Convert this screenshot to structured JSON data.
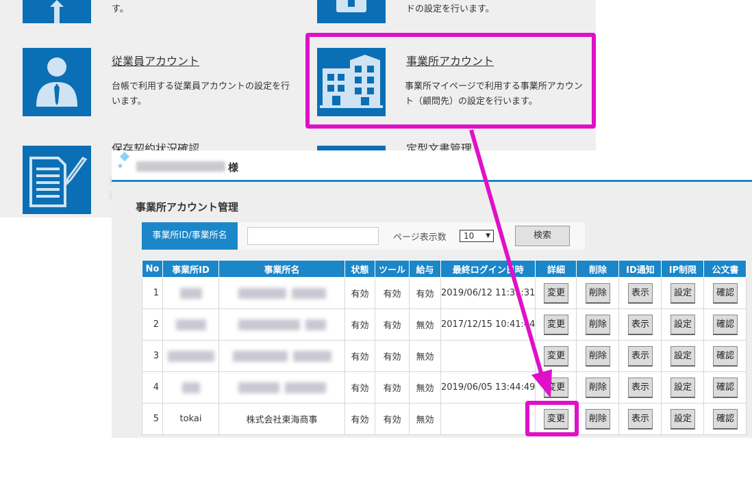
{
  "menu": {
    "top_left_desc": "す。",
    "top_right_desc": "ドの設定を行います。",
    "employee": {
      "title": "従業員アカウント",
      "desc_line1": "台帳で利用する従業員アカウントの設定を行",
      "desc_line2": "います。"
    },
    "office": {
      "title": "事業所アカウント",
      "desc_line1": "事業所マイページで利用する事業所アカウン",
      "desc_line2": "ト（顧問先）の設定を行います。"
    },
    "bottom_left_title_partial": "保存契約状況確認",
    "bottom_right_title_partial": "定型文書管理"
  },
  "header": {
    "user_suffix": "様"
  },
  "page": {
    "title": "事業所アカウント管理"
  },
  "search": {
    "label": "事業所ID/事業所名",
    "input_value": "",
    "page_size_label": "ページ表示数",
    "page_size_value": "10",
    "button_label": "検索"
  },
  "table": {
    "columns": [
      "No",
      "事業所ID",
      "事業所名",
      "状態",
      "ツール",
      "給与",
      "最終ログイン日時",
      "詳細",
      "削除",
      "ID通知",
      "IP制限",
      "公文書"
    ],
    "rows": [
      {
        "no": "1",
        "office_id": "",
        "office_name": "",
        "status": "有効",
        "tool": "有効",
        "salary": "有効",
        "last_login": "2019/06/12 11:31:31",
        "detail": "変更",
        "delete": "削除",
        "id_notice": "表示",
        "ip_limit": "設定",
        "document": "確認"
      },
      {
        "no": "2",
        "office_id": "",
        "office_name": "",
        "status": "有効",
        "tool": "有効",
        "salary": "無効",
        "last_login": "2017/12/15 10:41:44",
        "detail": "変更",
        "delete": "削除",
        "id_notice": "表示",
        "ip_limit": "設定",
        "document": "確認"
      },
      {
        "no": "3",
        "office_id": "",
        "office_name": "",
        "status": "有効",
        "tool": "有効",
        "salary": "無効",
        "last_login": "",
        "detail": "変更",
        "delete": "削除",
        "id_notice": "表示",
        "ip_limit": "設定",
        "document": "確認"
      },
      {
        "no": "4",
        "office_id": "",
        "office_name": "",
        "status": "有効",
        "tool": "有効",
        "salary": "無効",
        "last_login": "2019/06/05 13:44:49",
        "detail": "変更",
        "delete": "削除",
        "id_notice": "表示",
        "ip_limit": "設定",
        "document": "確認"
      },
      {
        "no": "5",
        "office_id": "tokai",
        "office_name": "株式会社東海商事",
        "status": "有効",
        "tool": "有効",
        "salary": "無効",
        "last_login": "",
        "detail": "変更",
        "delete": "削除",
        "id_notice": "表示",
        "ip_limit": "設定",
        "document": "確認"
      }
    ]
  },
  "colors": {
    "tile_blue": "#0a6fb5",
    "header_blue": "#1b86c8",
    "highlight_magenta": "#e010c8"
  },
  "icons": [
    "arrow-up-icon",
    "employee-person-icon",
    "office-building-icon",
    "document-pen-icon"
  ]
}
